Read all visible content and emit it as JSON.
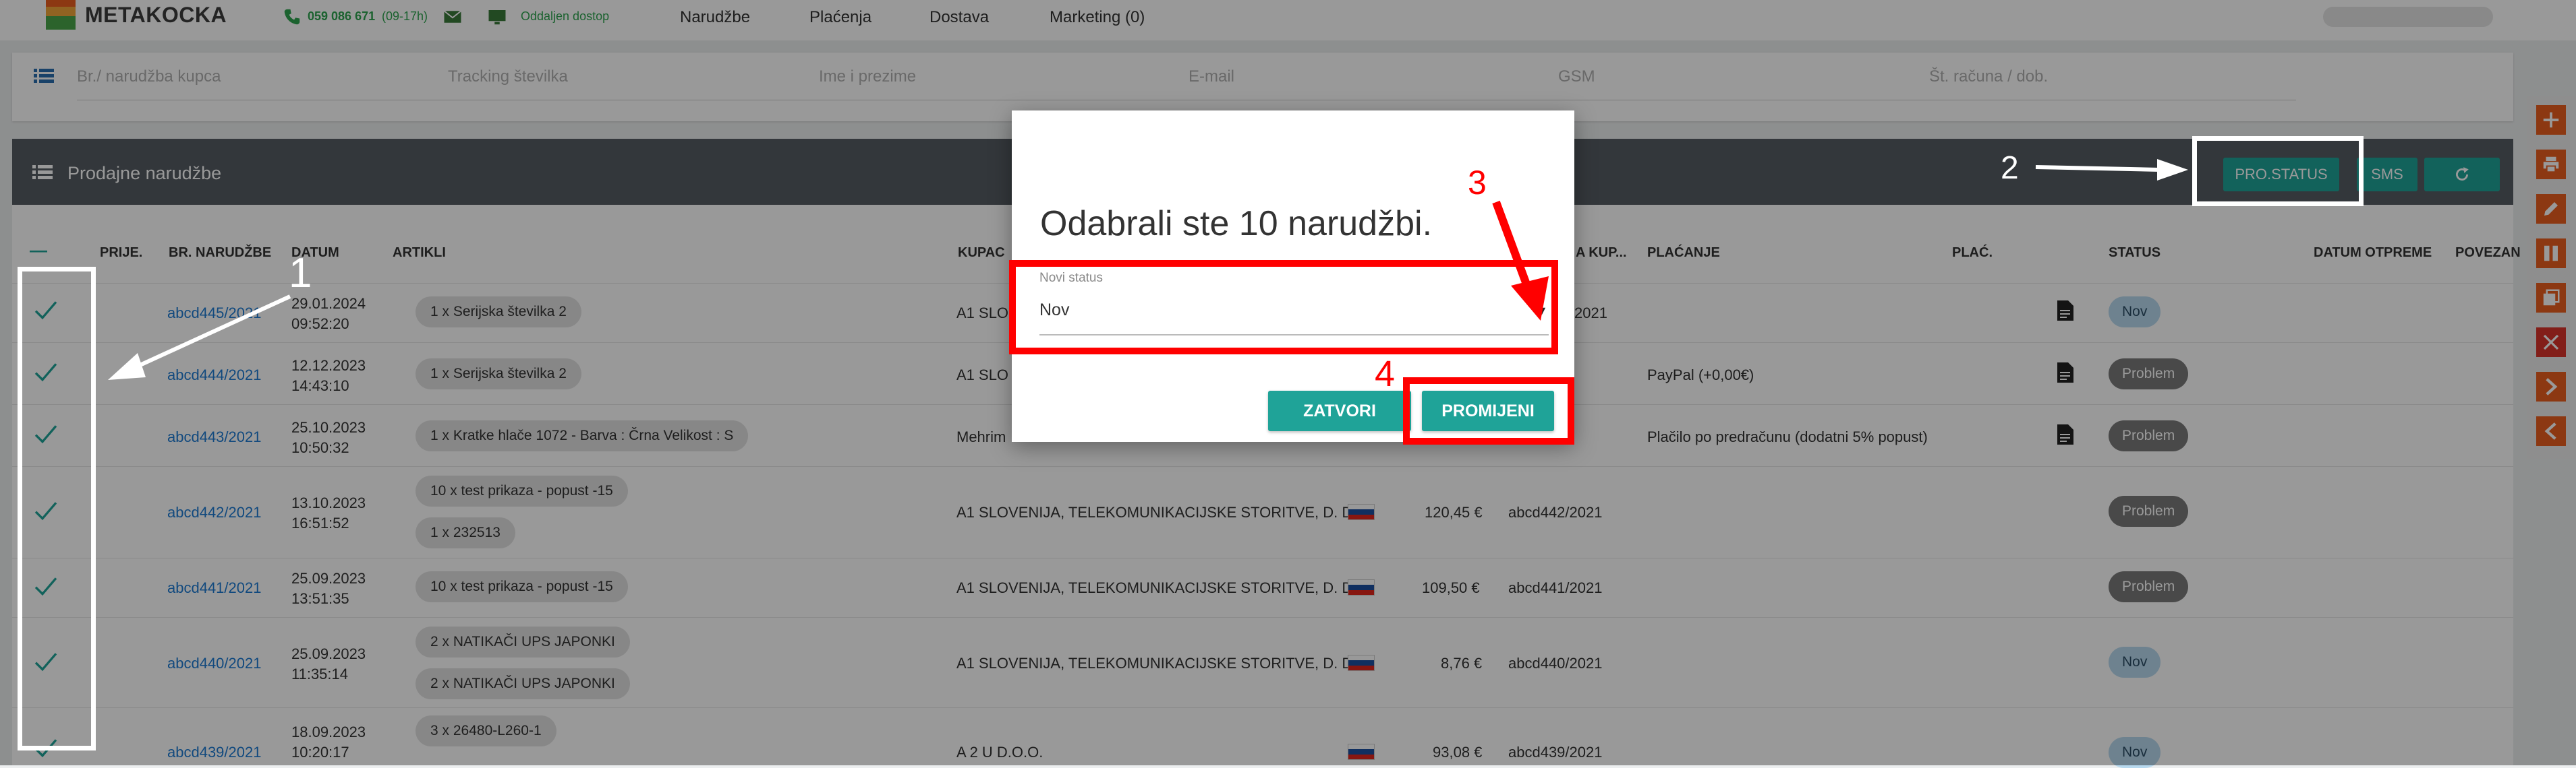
{
  "topbar": {
    "brand": "METAKOCKA",
    "phone": "059 086 671",
    "phone_hours": "(09-17h)",
    "remote_access": "Oddaljen dostop",
    "nav": [
      "Narudžbe",
      "Plaćenja",
      "Dostava",
      "Marketing (0)"
    ]
  },
  "search": {
    "fields": [
      "Br./ narudžba kupca",
      "Tracking številka",
      "Ime i prezime",
      "E-mail",
      "GSM",
      "Št. računa / dob."
    ]
  },
  "section": {
    "title": "Prodajne narudžbe",
    "buttons": {
      "status": "PRO.STATUS",
      "sms": "SMS"
    }
  },
  "table": {
    "headers": {
      "select": "—",
      "prije": "PRIJE.",
      "order_no": "BR. NARUDŽBE",
      "date": "DATUM",
      "articles": "ARTIKLI",
      "customer": "KUPAC",
      "customer_ref": "A KUP...",
      "payment": "PLAĆANJE",
      "paid": "PLAĆ.",
      "status": "STATUS",
      "ship_date": "DATUM OTPREME",
      "linked": "POVEZAN"
    },
    "rows": [
      {
        "order": "abcd445/2021",
        "date": "29.01.2024",
        "time": "09:52:20",
        "articles": [
          "1 x Serijska številka 2"
        ],
        "customer": "A1 SLO",
        "amount": "",
        "ref": "2021",
        "payment": "",
        "doc": true,
        "status": "Nov"
      },
      {
        "order": "abcd444/2021",
        "date": "12.12.2023",
        "time": "14:43:10",
        "articles": [
          "1 x Serijska številka 2"
        ],
        "customer": "A1 SLO",
        "amount": "",
        "ref": "",
        "payment": "PayPal (+0,00€)",
        "doc": true,
        "status": "Problem"
      },
      {
        "order": "abcd443/2021",
        "date": "25.10.2023",
        "time": "10:50:32",
        "articles": [
          "1 x Kratke hlače 1072 - Barva : Črna Velikost : S"
        ],
        "customer": "Mehrim",
        "amount": "",
        "ref": "",
        "payment": "Plačilo po predračunu (dodatni 5% popust)",
        "doc": true,
        "status": "Problem"
      },
      {
        "order": "abcd442/2021",
        "date": "13.10.2023",
        "time": "16:51:52",
        "articles": [
          "10 x test prikaza - popust -15",
          "1 x 232513"
        ],
        "customer": "A1 SLOVENIJA, TELEKOMUNIKACIJSKE STORITVE, D. D.",
        "amount": "120,45 €",
        "ref": "abcd442/2021",
        "payment": "",
        "doc": false,
        "status": "Problem"
      },
      {
        "order": "abcd441/2021",
        "date": "25.09.2023",
        "time": "13:51:35",
        "articles": [
          "10 x test prikaza - popust -15"
        ],
        "customer": "A1 SLOVENIJA, TELEKOMUNIKACIJSKE STORITVE, D. D.",
        "amount": "109,50 €",
        "ref": "abcd441/2021",
        "payment": "",
        "doc": false,
        "status": "Problem"
      },
      {
        "order": "abcd440/2021",
        "date": "25.09.2023",
        "time": "11:35:14",
        "articles": [
          "2 x NATIKAČI UPS JAPONKI",
          "2 x NATIKAČI UPS JAPONKI"
        ],
        "customer": "A1 SLOVENIJA, TELEKOMUNIKACIJSKE STORITVE, D. D.",
        "amount": "8,76 €",
        "ref": "abcd440/2021",
        "payment": "",
        "doc": false,
        "status": "Nov"
      },
      {
        "order": "abcd439/2021",
        "date": "18.09.2023",
        "time": "10:20:17",
        "articles": [
          "3 x 26480-L260-1"
        ],
        "customer": "A 2 U D.O.O.",
        "amount": "93,08 €",
        "ref": "abcd439/2021",
        "payment": "",
        "doc": false,
        "status": "Nov"
      }
    ]
  },
  "modal": {
    "title": "Odabrali ste 10 narudžbi.",
    "status_label": "Novi status",
    "status_value": "Nov",
    "close_button": "ZATVORI",
    "change_button": "PROMIJENI"
  },
  "annotations": {
    "n1": "1",
    "n2": "2",
    "n3": "3",
    "n4": "4"
  },
  "colors": {
    "accent": "#1fa398",
    "header_bg": "#555c63",
    "toolbar_orange": "#e95e1f",
    "annotation_red": "#ff0000",
    "badge_nov": "#b7d9ef",
    "badge_problem": "#7a7a7a"
  }
}
